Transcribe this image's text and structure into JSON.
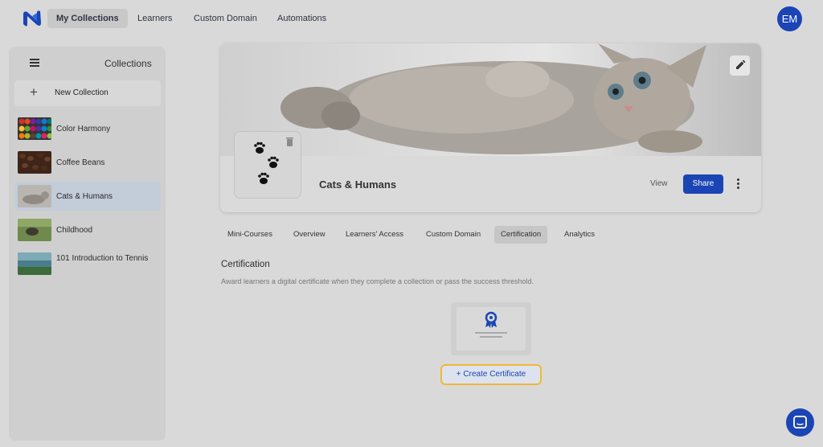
{
  "nav": {
    "items": [
      "My Collections",
      "Learners",
      "Custom Domain",
      "Automations"
    ],
    "avatar": "EM"
  },
  "sidebar": {
    "title": "Collections",
    "new_collection": "New Collection",
    "items": [
      {
        "label": "Color Harmony"
      },
      {
        "label": "Coffee Beans"
      },
      {
        "label": "Cats & Humans"
      },
      {
        "label": "Childhood"
      },
      {
        "label": "101 Introduction to Tennis"
      }
    ]
  },
  "collection": {
    "title": "Cats & Humans",
    "view": "View",
    "share": "Share"
  },
  "tabs": [
    "Mini-Courses",
    "Overview",
    "Learners' Access",
    "Custom Domain",
    "Certification",
    "Analytics"
  ],
  "certification": {
    "heading": "Certification",
    "description": "Award learners a digital certificate when they complete a collection or pass the success threshold.",
    "button": "+ Create Certificate"
  },
  "colors": {
    "accent": "#1b45b5",
    "highlight": "#f2b834",
    "background": "#d9d9d9"
  }
}
